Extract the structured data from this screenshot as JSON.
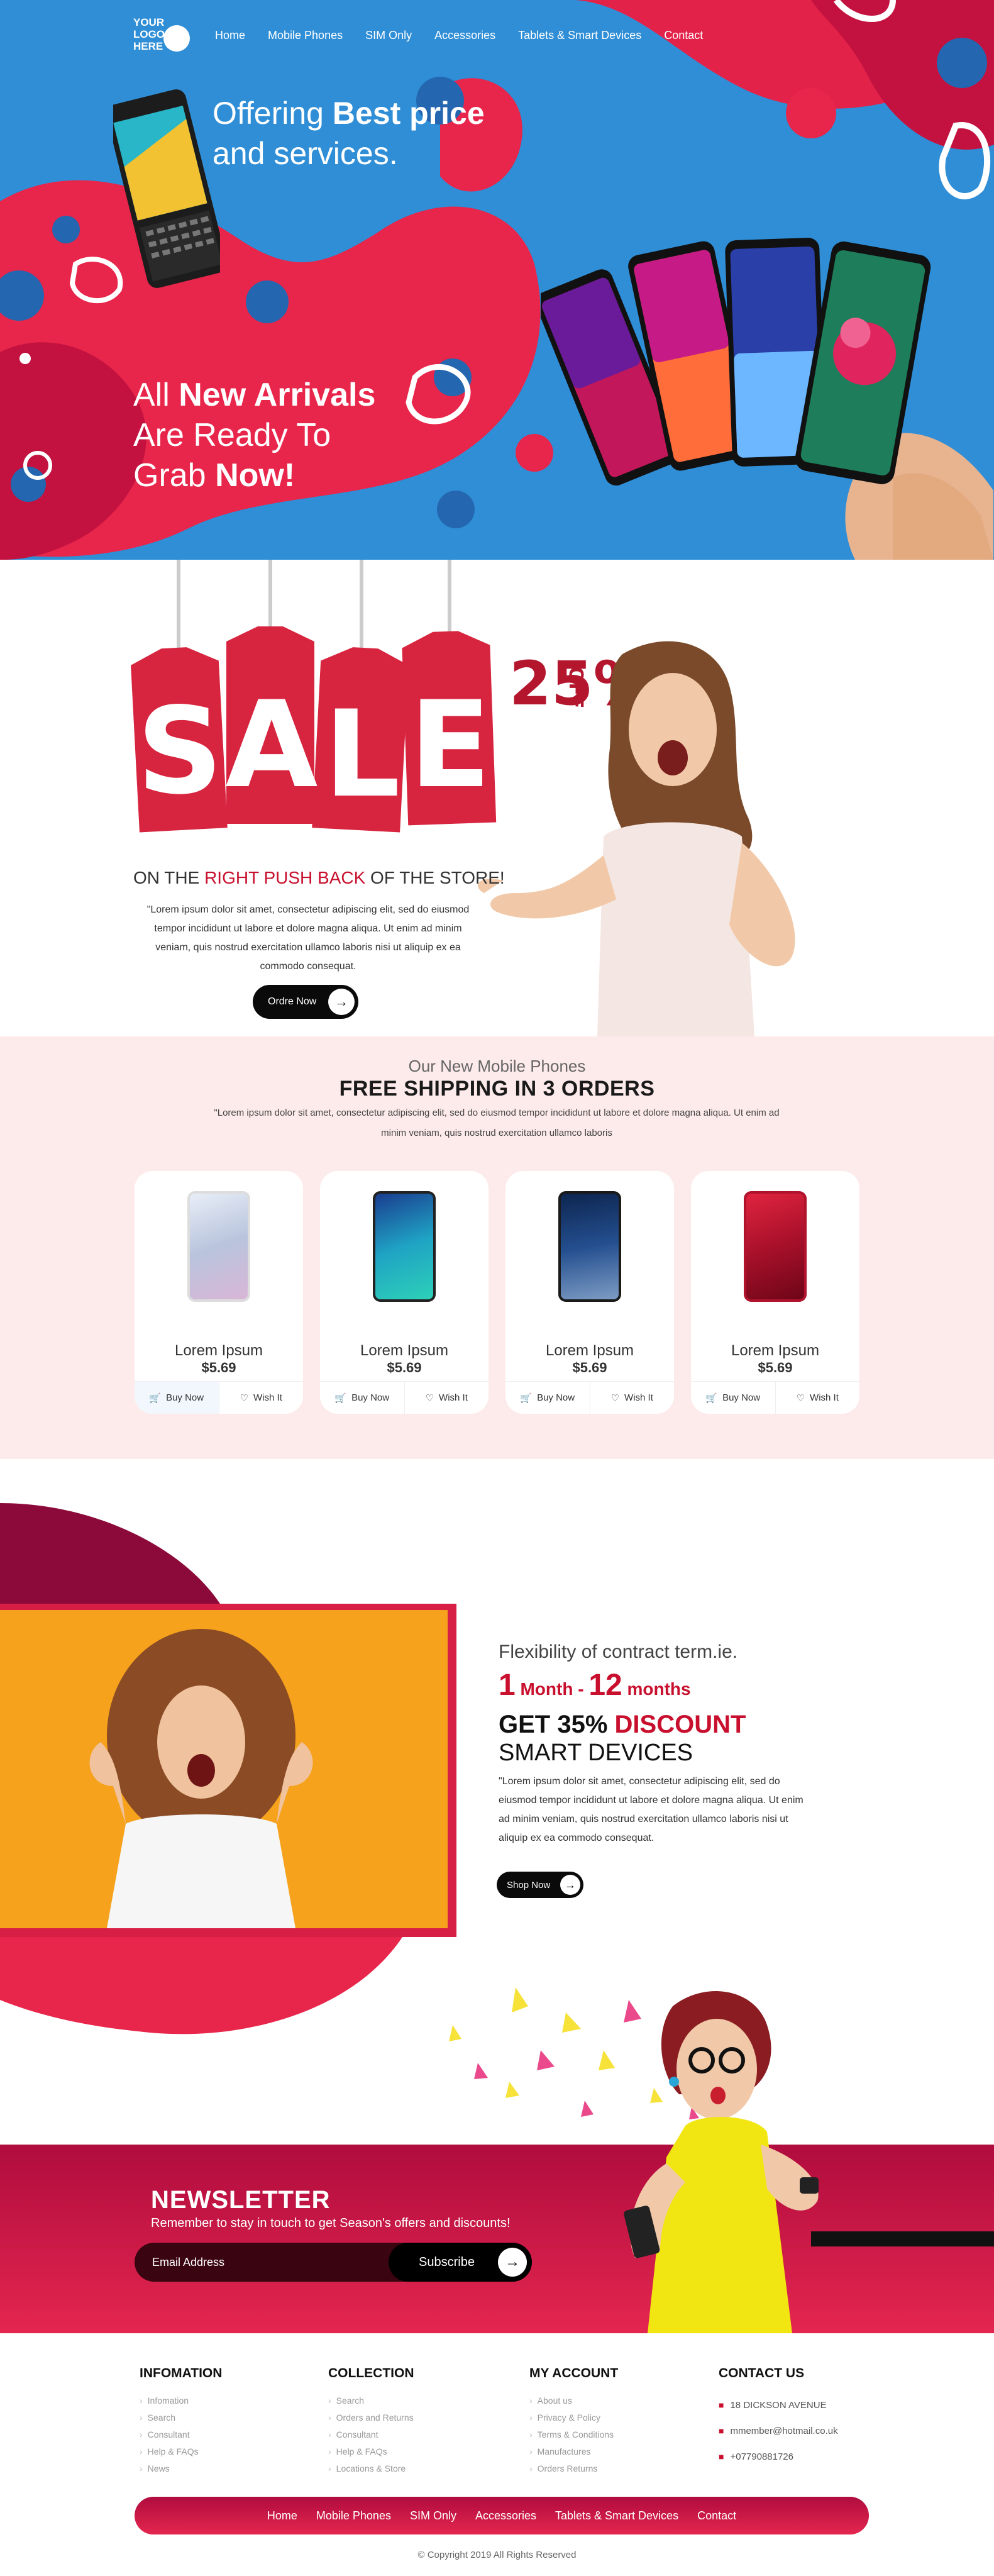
{
  "header": {
    "logo_lines": [
      "YOUR",
      "LOGO",
      "HERE"
    ],
    "nav": [
      "Home",
      "Mobile Phones",
      "SIM Only",
      "Accessories",
      "Tablets & Smart Devices",
      "Contact"
    ]
  },
  "hero": {
    "line1_regular": "Offering",
    "line1_bold": "Best price",
    "line2": "and services.",
    "arrivals_regular": "All",
    "arrivals_bold": "New Arrivals",
    "ready": "Are Ready To",
    "grab_regular": "Grab",
    "grab_bold": "Now!"
  },
  "sale": {
    "tag_letters": [
      "S",
      "A",
      "L",
      "E"
    ],
    "percent": "25%",
    "off": "OFF",
    "subtitle_pre": "ON THE",
    "subtitle_red": "RIGHT PUSH BACK",
    "subtitle_post": "OF THE STORE!",
    "text": "\"Lorem ipsum dolor sit amet, consectetur adipiscing elit, sed do eiusmod tempor incididunt ut labore et dolore magna aliqua. Ut enim ad minim veniam, quis nostrud exercitation ullamco laboris nisi ut aliquip ex ea commodo consequat.",
    "button": "Ordre Now"
  },
  "products": {
    "title": "Our New Mobile Phones",
    "heading": "FREE SHIPPING IN 3 ORDERS",
    "text": "\"Lorem ipsum dolor sit amet, consectetur adipiscing elit, sed do eiusmod tempor incididunt ut labore et dolore magna aliqua. Ut enim ad minim veniam, quis nostrud exercitation ullamco laboris",
    "buy_label": "Buy Now",
    "wish_label": "Wish It",
    "items": [
      {
        "name": "Lorem Ipsum",
        "price": "$5.69",
        "color": "#c9d3e6"
      },
      {
        "name": "Lorem Ipsum",
        "price": "$5.69",
        "color": "#1f8fb5"
      },
      {
        "name": "Lorem Ipsum",
        "price": "$5.69",
        "color": "#1b3f78"
      },
      {
        "name": "Lorem Ipsum",
        "price": "$5.69",
        "color": "#c4122c"
      }
    ]
  },
  "contract": {
    "flexibility": "Flexibility of contract term.ie.",
    "month_a_num": "1",
    "month_a_label": "Month -",
    "month_b_num": "12",
    "month_b_label": "months",
    "get": "GET 35%",
    "discount": "DISCOUNT",
    "smart": "SMART DEVICES",
    "text": "\"Lorem ipsum dolor sit amet, consectetur adipiscing elit, sed do eiusmod tempor incididunt ut labore et dolore magna aliqua. Ut enim ad minim veniam, quis nostrud exercitation ullamco laboris nisi ut aliquip ex ea commodo consequat.",
    "button": "Shop Now"
  },
  "newsletter": {
    "title": "NEWSLETTER",
    "subtitle": "Remember to stay in touch to get Season's offers and discounts!",
    "placeholder": "Email Address",
    "button": "Subscribe"
  },
  "footer": {
    "columns": [
      {
        "title": "INFOMATION",
        "items": [
          "Infomation",
          "Search",
          "Consultant",
          "Help & FAQs",
          "News"
        ]
      },
      {
        "title": "COLLECTION",
        "items": [
          "Search",
          "Orders and Returns",
          "Consultant",
          "Help & FAQs",
          "Locations & Store"
        ]
      },
      {
        "title": "MY ACCOUNT",
        "items": [
          "About us",
          "Privacy & Policy",
          "Terms & Conditions",
          "Manufactures",
          "Orders Returns"
        ]
      }
    ],
    "contact_title": "CONTACT US",
    "contact_items": [
      "18 DICKSON AVENUE",
      "mmember@hotmail.co.uk",
      "+07790881726"
    ],
    "nav": [
      "Home",
      "Mobile Phones",
      "SIM Only",
      "Accessories",
      "Tablets & Smart Devices",
      "Contact"
    ],
    "copyright": "© Copyright 2019 All Rights Reserved"
  },
  "colors": {
    "accent_red": "#c8102e",
    "hero_blue": "#2f8ed6",
    "hero_red": "#e8254a",
    "products_bg": "#fdeaea"
  }
}
